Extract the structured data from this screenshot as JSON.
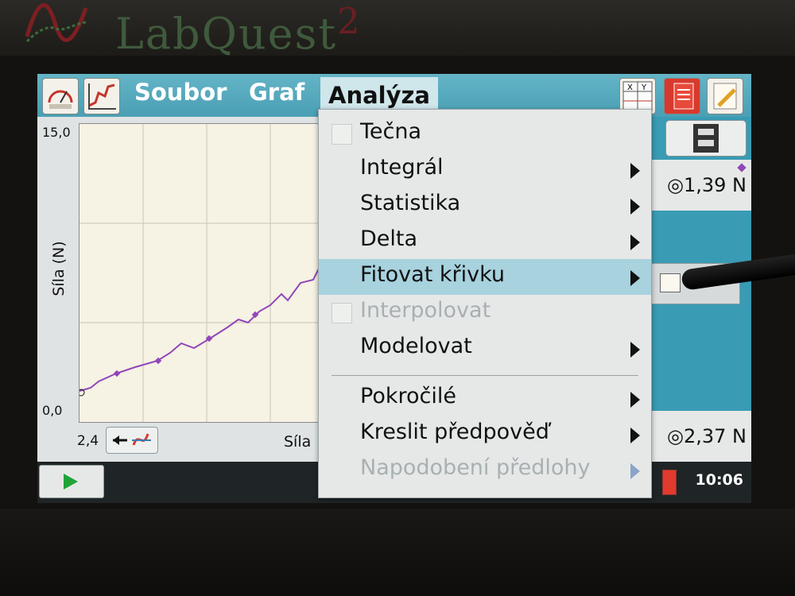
{
  "device": {
    "brand": "LabQuest",
    "brand_suffix": "2"
  },
  "toolbar": {
    "menus": [
      "Soubor",
      "Graf",
      "Analýza"
    ],
    "active_menu": "Analýza"
  },
  "graph": {
    "y_max": "15,0",
    "y_min": "0,0",
    "y_label": "Síla (N)",
    "x_min": "2,4",
    "x_label": "Síla"
  },
  "meters": [
    {
      "value": "◎1,39 N"
    },
    {
      "value": "◎2,37 N"
    }
  ],
  "status": {
    "clock": "10:06"
  },
  "colors": {
    "accent": "#4a9fb4",
    "series": "#9146b8",
    "highlight": "#a7d2de",
    "disabled": "#a9b0b2"
  },
  "dropdown": {
    "items": [
      {
        "label": "Tečna",
        "checkbox": true,
        "submenu": false,
        "disabled": false,
        "highlighted": false
      },
      {
        "label": "Integrál",
        "checkbox": false,
        "submenu": true,
        "disabled": false,
        "highlighted": false
      },
      {
        "label": "Statistika",
        "checkbox": false,
        "submenu": true,
        "disabled": false,
        "highlighted": false
      },
      {
        "label": "Delta",
        "checkbox": false,
        "submenu": true,
        "disabled": false,
        "highlighted": false
      },
      {
        "label": "Fitovat křivku",
        "checkbox": false,
        "submenu": true,
        "disabled": false,
        "highlighted": true
      },
      {
        "label": "Interpolovat",
        "checkbox": true,
        "submenu": false,
        "disabled": true,
        "highlighted": false
      },
      {
        "label": "Modelovat",
        "checkbox": false,
        "submenu": true,
        "disabled": false,
        "highlighted": false
      },
      {
        "label": "Pokročilé",
        "checkbox": false,
        "submenu": true,
        "disabled": false,
        "highlighted": false
      },
      {
        "label": "Kreslit předpověď",
        "checkbox": false,
        "submenu": true,
        "disabled": false,
        "highlighted": false
      },
      {
        "label": "Napodobení předlohy",
        "checkbox": false,
        "submenu": true,
        "disabled": true,
        "highlighted": false
      }
    ]
  }
}
